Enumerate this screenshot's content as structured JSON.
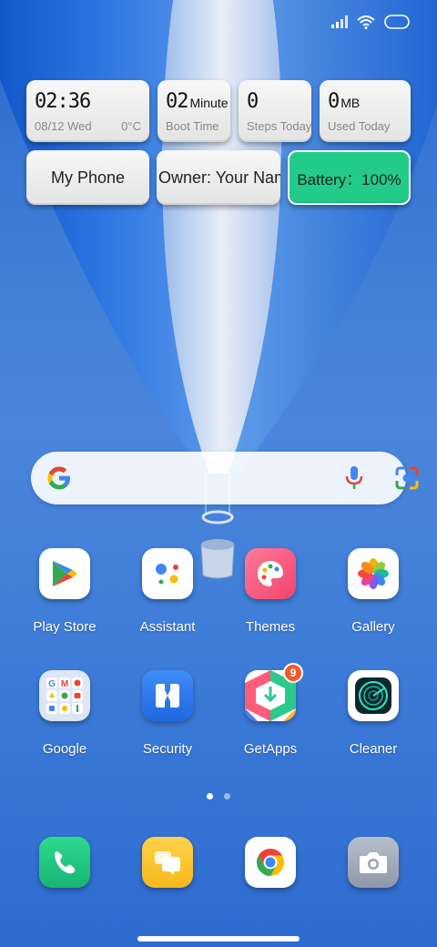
{
  "widgets": {
    "clock": {
      "time": "02:36",
      "date": "08/12 Wed",
      "temp": "0°C"
    },
    "boot": {
      "value": "02",
      "unit": "Minute",
      "label": "Boot Time"
    },
    "steps": {
      "value": "0",
      "label": "Steps Today"
    },
    "data": {
      "value": "0",
      "unit": "MB",
      "label": "Used Today"
    },
    "phone_label": "My Phone",
    "owner_label": "Owner: Your Name",
    "battery_label": "Battery：100%"
  },
  "apps_row1": [
    {
      "label": "Play Store",
      "icon": "play-store-icon"
    },
    {
      "label": "Assistant",
      "icon": "assistant-icon"
    },
    {
      "label": "Themes",
      "icon": "themes-icon"
    },
    {
      "label": "Gallery",
      "icon": "gallery-icon"
    }
  ],
  "apps_row2": [
    {
      "label": "Google",
      "icon": "google-folder-icon"
    },
    {
      "label": "Security",
      "icon": "security-icon"
    },
    {
      "label": "GetApps",
      "icon": "getapps-icon",
      "badge": "9"
    },
    {
      "label": "Cleaner",
      "icon": "cleaner-icon"
    }
  ],
  "dock": [
    {
      "icon": "phone-icon"
    },
    {
      "icon": "messages-icon"
    },
    {
      "icon": "chrome-icon"
    },
    {
      "icon": "camera-icon"
    }
  ],
  "colors": {
    "battery": "#22cc88",
    "badge": "#f0592b"
  }
}
